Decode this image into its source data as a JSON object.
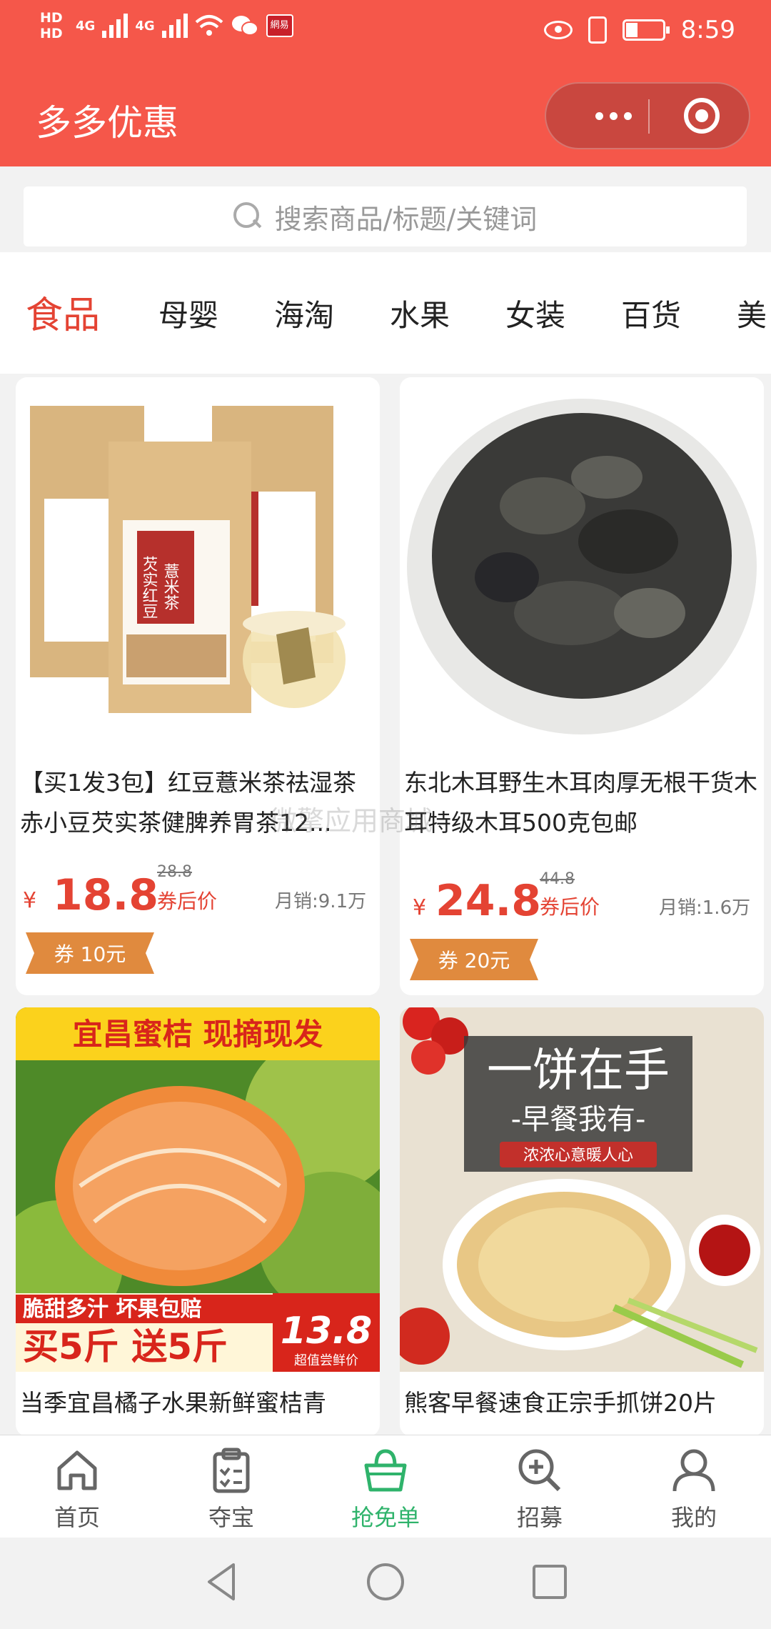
{
  "status_bar": {
    "hd1": "HD",
    "hd2": "HD",
    "signal1": "4G",
    "signal2": "4G",
    "netease": "網易",
    "time": "8:59"
  },
  "header": {
    "title": "多多优惠",
    "more_icon": "more-dots-icon",
    "close_icon": "target-circle-icon"
  },
  "search": {
    "placeholder": "搜索商品/标题/关键词"
  },
  "categories": [
    "食品",
    "母婴",
    "海淘",
    "水果",
    "女装",
    "百货",
    "美"
  ],
  "products": [
    {
      "title": "【买1发3包】红豆薏米茶祛湿茶赤小豆芡实茶健脾养胃茶12...",
      "original": "28.8",
      "currency": "¥",
      "price": "18.8",
      "after_label": "券后价",
      "sales": "月销:9.1万",
      "coupon": "券 10元",
      "image_text": [
        "芡实红豆",
        "薏米茶"
      ]
    },
    {
      "title": "东北木耳野生木耳肉厚无根干货木耳特级木耳500克包邮",
      "original": "44.8",
      "currency": "¥",
      "price": "24.8",
      "after_label": "券后价",
      "sales": "月销:1.6万",
      "coupon": "券 20元"
    },
    {
      "title": "当季宜昌橘子水果新鲜蜜桔青",
      "image_text": {
        "banner": "宜昌蜜桔 现摘现发",
        "sub": "脆甜多汁 坏果包赔",
        "deal": "买5斤 送5斤",
        "price": "13.8",
        "price_note": "超值尝鲜价"
      }
    },
    {
      "title": "熊客早餐速食正宗手抓饼20片",
      "image_text": {
        "headline": "一饼在手",
        "sub": "-早餐我有-",
        "tag": "浓浓心意暖人心"
      }
    }
  ],
  "watermark": "微擎应用商城",
  "tabbar": [
    {
      "label": "首页",
      "icon": "home-icon"
    },
    {
      "label": "夺宝",
      "icon": "clipboard-icon"
    },
    {
      "label": "抢免单",
      "icon": "shopping-bag-icon"
    },
    {
      "label": "招募",
      "icon": "search-plus-icon"
    },
    {
      "label": "我的",
      "icon": "user-icon"
    }
  ],
  "colors": {
    "header": "#f5574a",
    "accent": "#e44333",
    "tab_active": "#2fb36b",
    "coupon": "#e08a3e"
  }
}
